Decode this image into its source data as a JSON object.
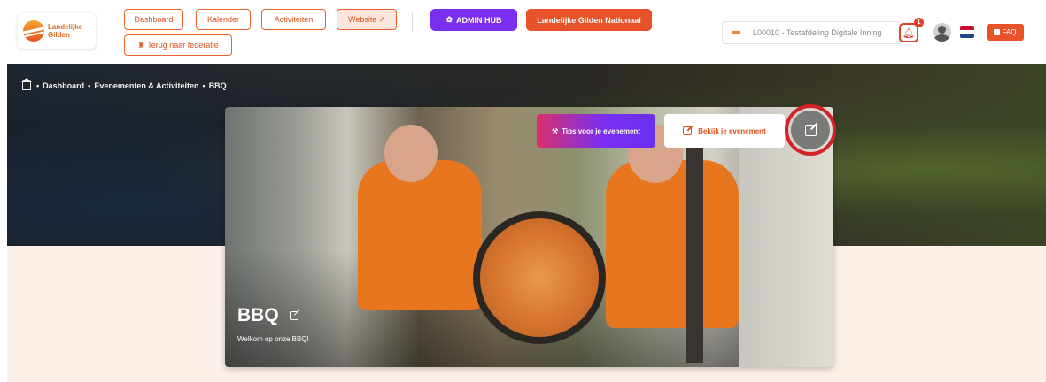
{
  "header": {
    "logo": {
      "line1": "Landelijke",
      "line2": "Gilden"
    },
    "nav": {
      "dashboard": "Dashboard",
      "kalender": "Kalender",
      "activiteiten": "Activiteiten",
      "website": "Website",
      "back_federation": "Terug naar federatie"
    },
    "admin_hub": "ADMIN HUB",
    "national": "Landelijke Gilden Nationaal",
    "org_select": "L00010 - Testafdeling Digitale Inning",
    "notifications_count": "1",
    "faq": "FAQ"
  },
  "breadcrumb": {
    "items": [
      "Dashboard",
      "Evenementen & Activiteiten",
      "BBQ"
    ],
    "separator": "•"
  },
  "event": {
    "title": "BBQ",
    "subtitle": "Welkom op onze BBQ!",
    "tips_button": "Tips voor je evenement",
    "view_button": "Bekijk je evenement"
  },
  "colors": {
    "accent_orange": "#e8522a",
    "admin_purple": "#7b2ff0",
    "highlight_red": "#d3222a"
  },
  "icons": {
    "home": "home-icon",
    "bell": "bell-icon",
    "avatar": "user-avatar-icon",
    "flag": "netherlands-flag-icon",
    "edit": "edit-icon",
    "tips": "magic-wand-icon",
    "admin": "gear-icon"
  }
}
